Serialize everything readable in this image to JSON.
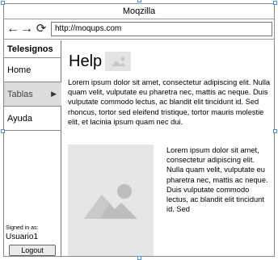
{
  "window": {
    "title": "Moqzilla"
  },
  "toolbar": {
    "back_icon": "arrow-left",
    "forward_icon": "arrow-right",
    "reload_icon": "reload",
    "url": "http://moqups.com"
  },
  "sidebar": {
    "brand": "Telesignos",
    "items": [
      {
        "label": "Home"
      },
      {
        "label": "Tablas",
        "active": true,
        "has_submenu": true
      },
      {
        "label": "Ayuda"
      }
    ],
    "signed_in_label": "Signed in as:",
    "user": "Usuario1",
    "logout_label": "Logout"
  },
  "main": {
    "title": "Help",
    "paragraph": "Lorem ipsum dolor sit amet, consectetur adipiscing elit. Nulla quam velit, vulputate eu pharetra nec, mattis ac neque. Duis vulputate commodo lectus, ac blandit elit tincidunt id. Sed rhoncus, tortor sed eleifend tristique, tortor mauris molestie elit, et lacinia ipsum quam nec dui.",
    "side_text": "Lorem ipsum dolor sit amet, consectetur adipiscing elit. Nulla quam velit, vulputate eu pharetra nec, mattis ac neque. Duis vulputate commodo lectus, ac blandit elit tincidunt id. Sed"
  }
}
